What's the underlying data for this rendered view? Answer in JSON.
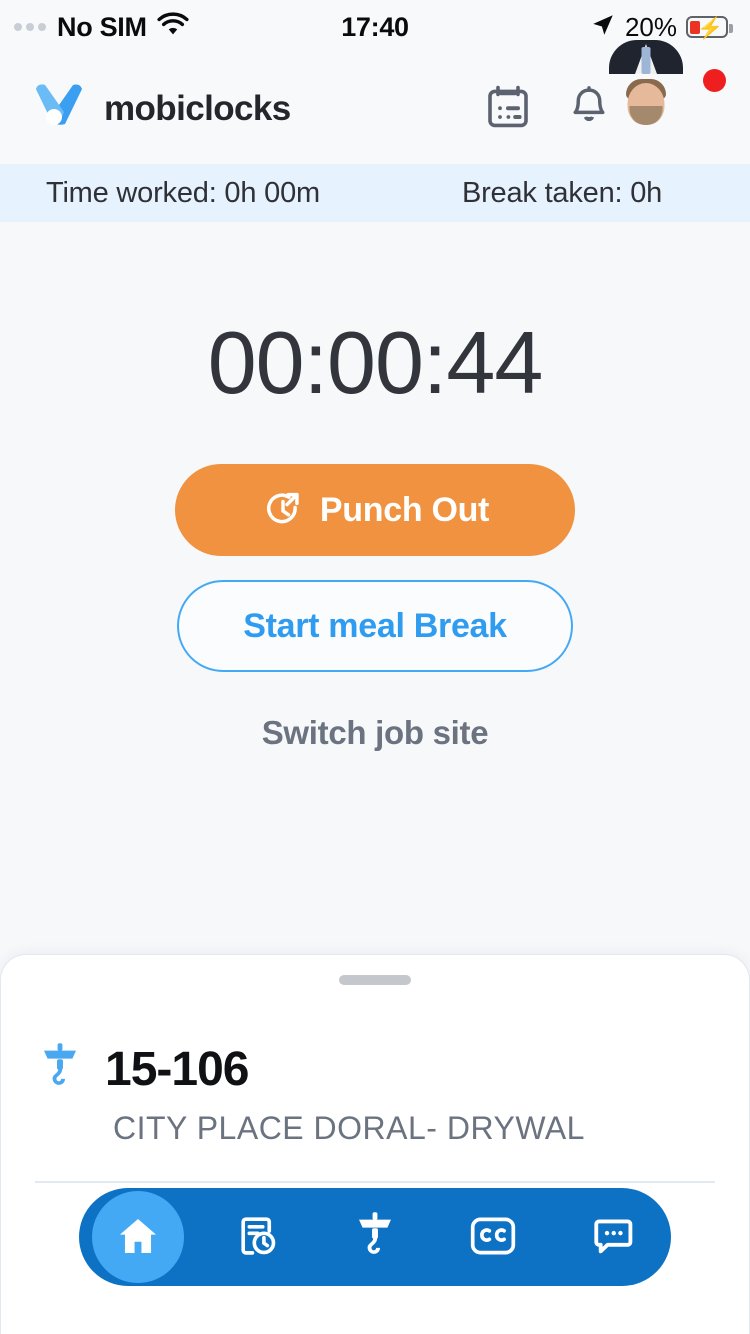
{
  "statusbar": {
    "carrier": "No SIM",
    "time": "17:40",
    "battery": "20%",
    "wifi_icon": "wifi-icon",
    "location_icon": "location-arrow-icon",
    "battery_icon": "battery-charging-icon"
  },
  "header": {
    "brand": "mobiclocks",
    "logo_icon": "mobiclocks-logo-icon",
    "calendar_icon": "calendar-icon",
    "bell_icon": "bell-icon",
    "avatar_icon": "user-avatar",
    "notification_badge": ""
  },
  "infobar": {
    "time_worked": "Time worked:  0h 00m",
    "break_taken": "Break taken:  0h"
  },
  "main": {
    "timer": "00:00:44",
    "punch_out_label": "Punch Out",
    "punch_out_icon": "clock-arrow-out-icon",
    "start_break_label": "Start meal Break",
    "switch_site_label": "Switch job site"
  },
  "sheet": {
    "grabber": "drag-handle",
    "site_icon": "crane-hook-icon",
    "site_code": "15-106",
    "site_name": "CITY PLACE DORAL- DRYWAL"
  },
  "nav": {
    "items": [
      {
        "name": "home",
        "icon": "home-icon",
        "active": true
      },
      {
        "name": "timesheet",
        "icon": "document-clock-icon",
        "active": false
      },
      {
        "name": "jobsites",
        "icon": "crane-hook-icon",
        "active": false
      },
      {
        "name": "cost-codes",
        "icon": "cc-badge-icon",
        "active": false
      },
      {
        "name": "messages",
        "icon": "chat-bubble-icon",
        "active": false
      }
    ]
  },
  "colors": {
    "accent_orange": "#f0923f",
    "accent_blue": "#2f9cf0",
    "nav_blue": "#0d72c4",
    "nav_active": "#43a9f5",
    "info_bg": "#e6f2fd",
    "page_bg": "#f6f8fa",
    "badge_red": "#f01f1f"
  }
}
